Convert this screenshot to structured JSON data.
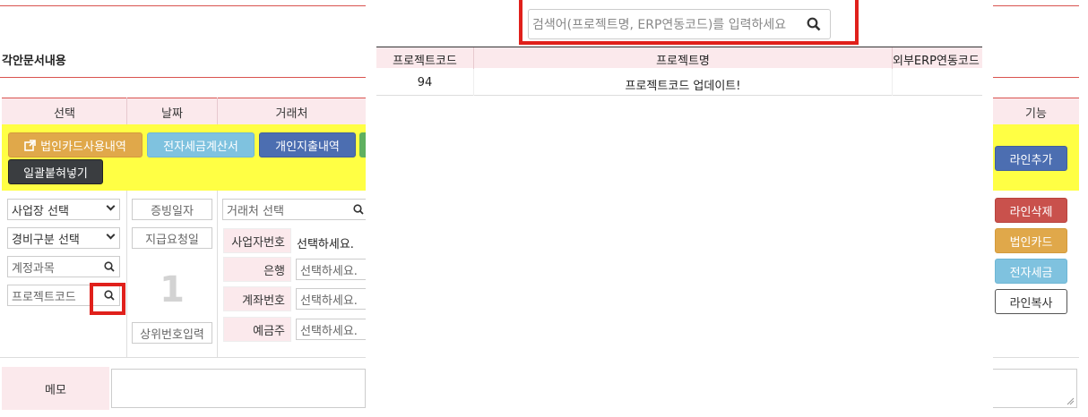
{
  "page": {
    "section_title": "각안문서내용"
  },
  "columns": {
    "select": "선택",
    "date": "날짜",
    "vendor": "거래처",
    "function": "기능"
  },
  "toolbar": {
    "corp_card_history": "법인카드사용내역",
    "e_tax_invoice": "전자세금계산서",
    "personal_expense": "개인지출내역",
    "bulk_paste": "일괄붙혀넣기",
    "add_line": "라인추가"
  },
  "row": {
    "business_select": "사업장 선택",
    "expense_type_select": "경비구분 선택",
    "account_subject": "계정과목",
    "project_code": "프로젝트코드",
    "evidence_date": "증빙일자",
    "payment_request_date": "지급요청일",
    "line_number": "1",
    "parent_number_input": "상위번호입력",
    "vendor_select": "거래처 선택",
    "business_number_label": "사업자번호",
    "business_number_value": "선택하세요.",
    "bank_label": "은행",
    "bank_placeholder": "선택하세요.",
    "account_label": "계좌번호",
    "account_placeholder": "선택하세요.",
    "depositor_label": "예금주",
    "depositor_placeholder": "선택하세요.",
    "delete_line": "라인삭제",
    "corp_card": "법인카드",
    "e_tax": "전자세금",
    "copy_line": "라인복사"
  },
  "memo": {
    "label": "메모"
  },
  "modal": {
    "search_placeholder": "검색어(프로젝트명, ERP연동코드)를 입력하세요",
    "headers": {
      "code": "프로젝트코드",
      "name": "프로젝트명",
      "erp": "외부ERP연동코드"
    },
    "rows": [
      {
        "code": "94",
        "name": "프로젝트코드 업데이트!",
        "erp": ""
      }
    ]
  }
}
